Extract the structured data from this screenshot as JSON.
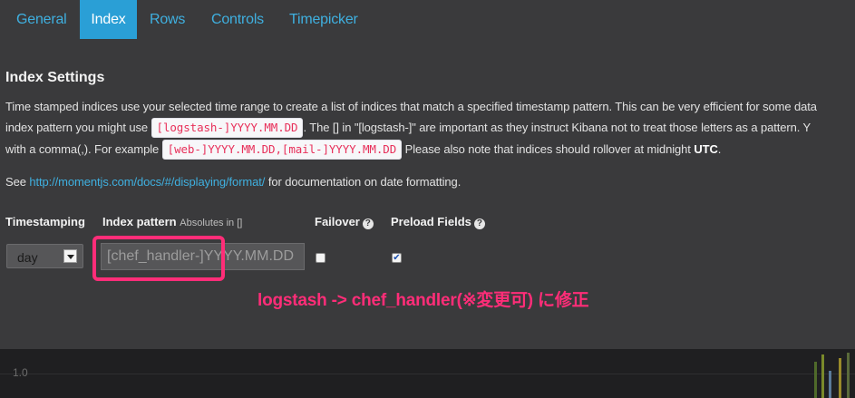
{
  "tabs": [
    {
      "label": "General",
      "active": false
    },
    {
      "label": "Index",
      "active": true
    },
    {
      "label": "Rows",
      "active": false
    },
    {
      "label": "Controls",
      "active": false
    },
    {
      "label": "Timepicker",
      "active": false
    }
  ],
  "section_title": "Index Settings",
  "paragraph": {
    "line1": "Time stamped indices use your selected time range to create a list of indices that match a specified timestamp pattern. This can be very efficient for some data",
    "line2_pre": "index pattern you might use",
    "line2_code": "[logstash-]YYYY.MM.DD",
    "line2_post": ". The [] in \"[logstash-]\" are important as they instruct Kibana not to treat those letters as a pattern. Y",
    "line3_pre": "with a comma(,). For example",
    "line3_code": "[web-]YYYY.MM.DD,[mail-]YYYY.MM.DD",
    "line3_post": "Please also note that indices should rollover at midnight",
    "line3_strong": "UTC",
    "line3_end": "."
  },
  "see_line": {
    "pre": "See",
    "link": "http://momentjs.com/docs/#/displaying/format/",
    "post": "for documentation on date formatting."
  },
  "fields": {
    "timestamping_label": "Timestamping",
    "index_pattern_label": "Index pattern",
    "index_pattern_hint": "Absolutes in []",
    "failover_label": "Failover",
    "preload_label": "Preload Fields",
    "timestamping_value": "day",
    "index_pattern_value": "[chef_handler-]YYYY.MM.DD",
    "failover_checked": false,
    "preload_checked": true
  },
  "icons": {
    "help": "help-circle-icon",
    "dropdown": "chevron-down-icon",
    "check": "check-icon"
  },
  "annotation": "logstash -> chef_handler(※変更可) に修正",
  "background_chart": {
    "tick_label": "1.0"
  },
  "colors": {
    "accent": "#2a9fd6",
    "link": "#3fb0e0",
    "code": "#e8305a",
    "annotation": "#ff2d78",
    "panel": "#3a3a3c"
  }
}
